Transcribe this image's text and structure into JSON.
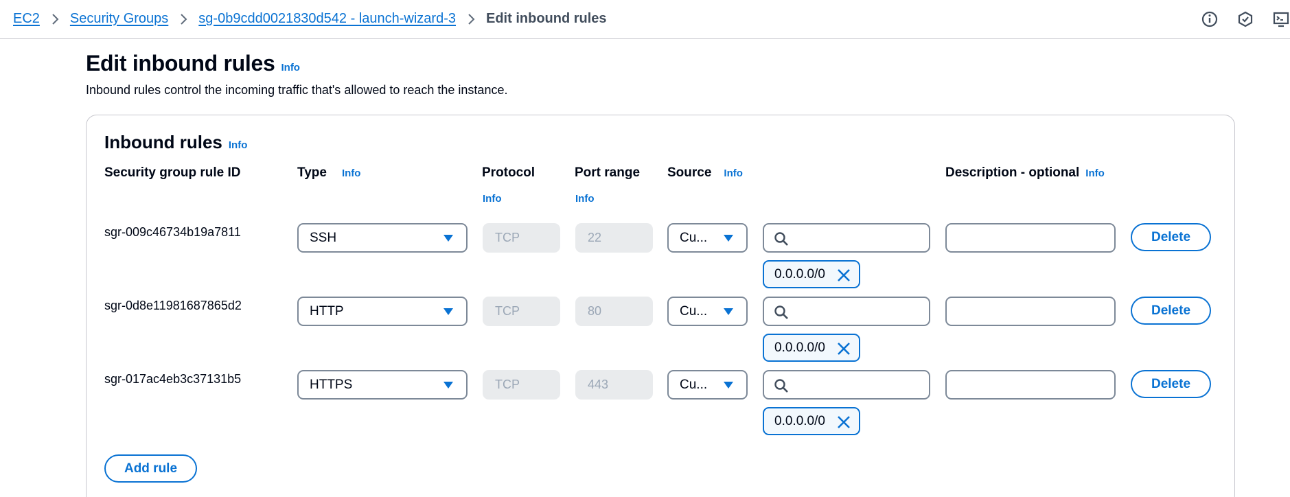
{
  "breadcrumb": {
    "items": [
      "EC2",
      "Security Groups",
      "sg-0b9cdd0021830d542 - launch-wizard-3"
    ],
    "current": "Edit inbound rules"
  },
  "header": {
    "title": "Edit inbound rules",
    "info": "Info",
    "description": "Inbound rules control the incoming traffic that's allowed to reach the instance."
  },
  "panel": {
    "title": "Inbound rules",
    "info": "Info",
    "columns": {
      "rule_id": "Security group rule ID",
      "type": "Type",
      "protocol": "Protocol",
      "port_range": "Port range",
      "source": "Source",
      "description": "Description - optional",
      "info": "Info"
    },
    "rules": [
      {
        "id": "sgr-009c46734b19a7811",
        "type": "SSH",
        "protocol": "TCP",
        "port": "22",
        "source": "Cu...",
        "cidr": "0.0.0.0/0",
        "delete": "Delete"
      },
      {
        "id": "sgr-0d8e11981687865d2",
        "type": "HTTP",
        "protocol": "TCP",
        "port": "80",
        "source": "Cu...",
        "cidr": "0.0.0.0/0",
        "delete": "Delete"
      },
      {
        "id": "sgr-017ac4eb3c37131b5",
        "type": "HTTPS",
        "protocol": "TCP",
        "port": "443",
        "source": "Cu...",
        "cidr": "0.0.0.0/0",
        "delete": "Delete"
      }
    ],
    "add_rule": "Add rule"
  },
  "colors": {
    "link": "#0972d3",
    "text": "#000716",
    "border": "#7d8998",
    "disabled_bg": "#e9ebed"
  },
  "icons": [
    "chevron-right-icon",
    "info-circle-icon",
    "settings-hexagon-icon",
    "cloudshell-icon",
    "caret-down-icon",
    "search-icon",
    "close-icon"
  ]
}
